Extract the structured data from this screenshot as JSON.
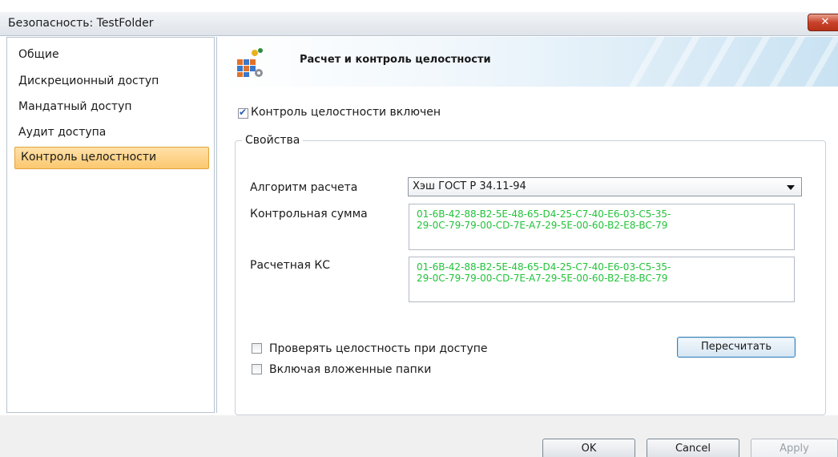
{
  "window": {
    "title": "Безопасность: TestFolder",
    "close_glyph": "✕"
  },
  "sidebar": {
    "items": [
      {
        "label": "Общие"
      },
      {
        "label": "Дискреционный доступ"
      },
      {
        "label": "Мандатный доступ"
      },
      {
        "label": "Аудит доступа"
      },
      {
        "label": "Контроль целостности",
        "selected": true
      }
    ]
  },
  "header": {
    "title": "Расчет и контроль целостности",
    "icon": "integrity-icon"
  },
  "integrity_enabled": {
    "label": "Контроль целостности включен",
    "checked": true
  },
  "properties": {
    "group_title": "Свойства",
    "algorithm_label": "Алгоритм расчета",
    "algorithm_value": "Хэш ГОСТ Р 34.11-94",
    "checksum_label": "Контрольная сумма",
    "checksum_value": "01-6B-42-88-B2-5E-48-65-D4-25-C7-40-E6-03-C5-35-\n29-0C-79-79-00-CD-7E-A7-29-5E-00-60-B2-E8-BC-79",
    "computed_label": "Расчетная КС",
    "computed_value": "01-6B-42-88-B2-5E-48-65-D4-25-C7-40-E6-03-C5-35-\n29-0C-79-79-00-CD-7E-A7-29-5E-00-60-B2-E8-BC-79",
    "check_on_access_label": "Проверять целостность при доступе",
    "check_on_access_checked": false,
    "include_subfolders_label": "Включая вложенные папки",
    "include_subfolders_checked": false,
    "recalc_label": "Пересчитать"
  },
  "footer": {
    "ok_label": "OK",
    "cancel_label": "Cancel",
    "apply_label": "Apply"
  },
  "colors": {
    "hash_text": "#22c33a",
    "selected_item": "#fbc86f",
    "close_button": "#c9432c"
  }
}
